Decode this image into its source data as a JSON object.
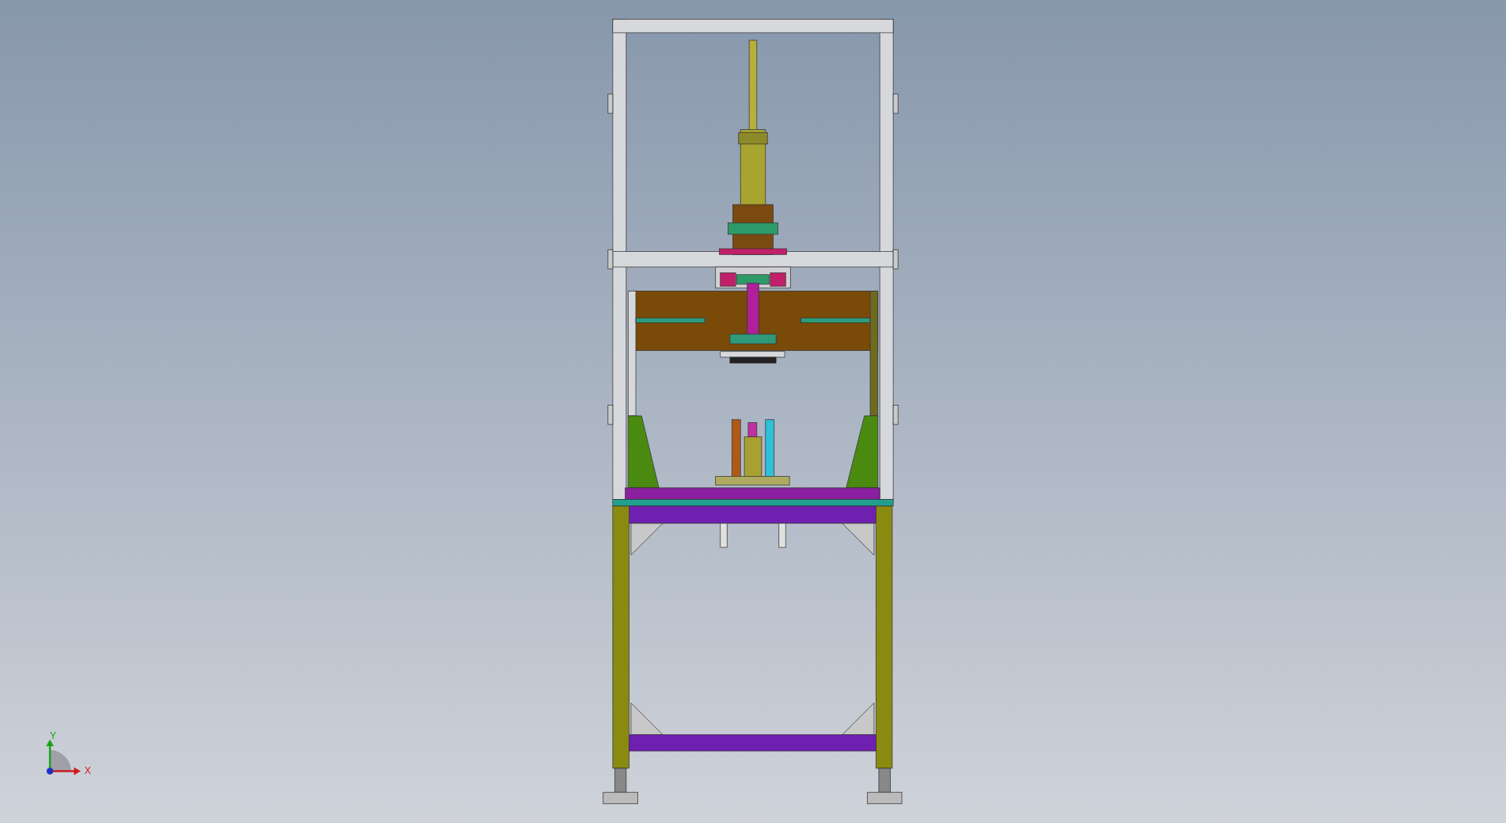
{
  "viewport": {
    "axis_triad": {
      "axes": [
        {
          "kind": "y",
          "label": "Y"
        },
        {
          "kind": "x",
          "label": "X"
        }
      ]
    }
  }
}
